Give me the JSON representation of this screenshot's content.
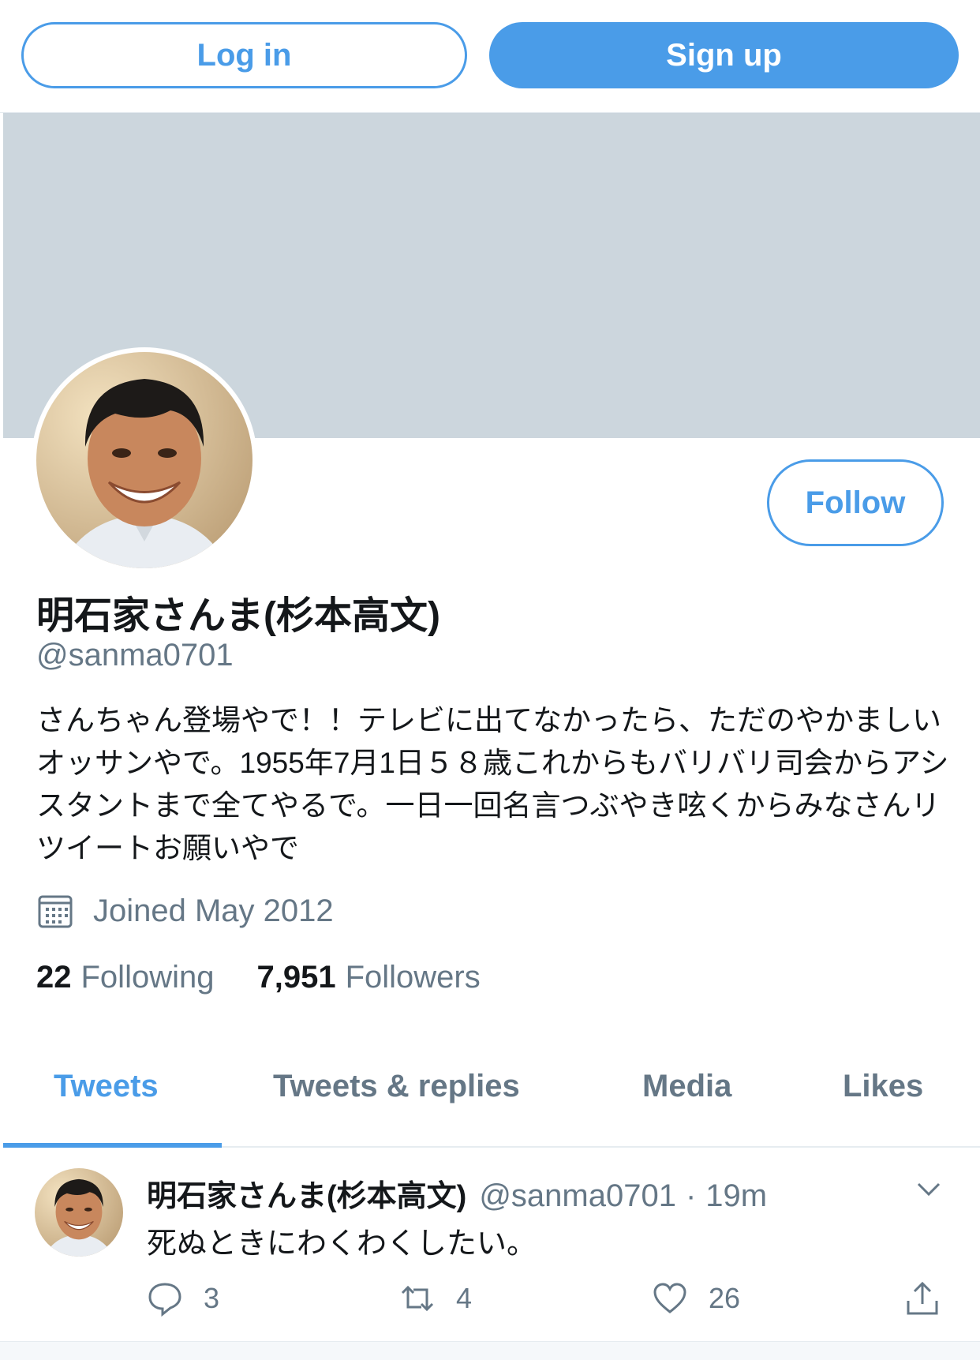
{
  "header": {
    "login_label": "Log in",
    "signup_label": "Sign up"
  },
  "profile": {
    "follow_label": "Follow",
    "display_name": "明石家さんま(杉本高文)",
    "handle": "@sanma0701",
    "bio": "さんちゃん登場やで！！テレビに出てなかったら、ただのやかましいオッサンやで。1955年7月1日５８歳これからもバリバリ司会からアシスタントまで全てやるで。一日一回名言つぶやき呟くからみなさんリツイートお願いやで",
    "joined": "Joined May 2012",
    "following_count": "22",
    "following_label": "Following",
    "followers_count": "7,951",
    "followers_label": "Followers"
  },
  "tabs": [
    {
      "label": "Tweets",
      "active": true
    },
    {
      "label": "Tweets & replies",
      "active": false
    },
    {
      "label": "Media",
      "active": false
    },
    {
      "label": "Likes",
      "active": false
    }
  ],
  "tweet": {
    "name": "明石家さんま(杉本高文)",
    "handle": "@sanma0701",
    "dot": "·",
    "time": "19m",
    "text": "死ぬときにわくわくしたい。",
    "reply_count": "3",
    "retweet_count": "4",
    "like_count": "26"
  },
  "colors": {
    "accent": "#4a9ce8",
    "banner": "#ccd6dd",
    "secondary_text": "#657786"
  }
}
